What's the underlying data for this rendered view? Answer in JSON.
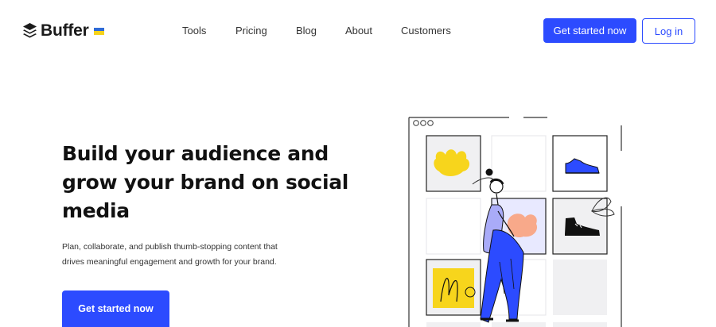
{
  "brand": {
    "name": "Buffer",
    "logo_icon": "buffer-stack-icon",
    "flag_icon": "ukraine-flag-icon",
    "flag_colors": [
      "#2f6bd7",
      "#f6d31c"
    ]
  },
  "nav": {
    "items": [
      {
        "label": "Tools"
      },
      {
        "label": "Pricing"
      },
      {
        "label": "Blog"
      },
      {
        "label": "About"
      },
      {
        "label": "Customers"
      }
    ]
  },
  "header_actions": {
    "primary_label": "Get started now",
    "secondary_label": "Log in"
  },
  "hero": {
    "title": "Build your audience and grow your brand on social media",
    "subtitle": "Plan, collaborate, and publish thumb-stopping content that drives meaningful engagement and growth for your brand.",
    "cta_label": "Get started now"
  },
  "colors": {
    "accent": "#2c4bff",
    "text": "#111111",
    "illustration_yellow": "#f7d51c",
    "illustration_peach": "#f8a98a",
    "illustration_blue": "#2c4bff",
    "illustration_gray": "#f0f0f2"
  }
}
